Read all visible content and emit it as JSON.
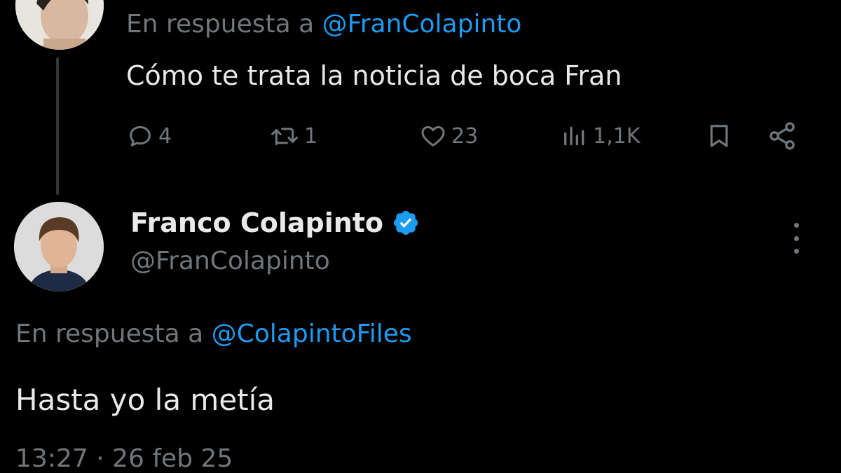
{
  "parent_tweet": {
    "reply_to_prefix": "En respuesta a",
    "reply_to_handle": "@FranColapinto",
    "text": "Cómo te trata la noticia de boca Fran",
    "actions": {
      "replies": "4",
      "retweets": "1",
      "likes": "23",
      "views": "1,1K"
    }
  },
  "main_tweet": {
    "author_name": "Franco Colapinto",
    "author_handle": "@FranColapinto",
    "verified": true,
    "reply_to_prefix": "En respuesta a",
    "reply_to_handle": "@ColapintoFiles",
    "text": "Hasta yo la metía",
    "timestamp": "13:27 · 26 feb 25"
  },
  "icons": {
    "reply": "reply-icon",
    "retweet": "retweet-icon",
    "like": "heart-icon",
    "views": "views-icon",
    "bookmark": "bookmark-icon",
    "share": "share-icon",
    "verified": "verified-badge-icon",
    "more": "more-options-icon"
  },
  "colors": {
    "background": "#000000",
    "text_primary": "#e7e9ea",
    "text_secondary": "#71767b",
    "accent": "#1d9bf0"
  }
}
